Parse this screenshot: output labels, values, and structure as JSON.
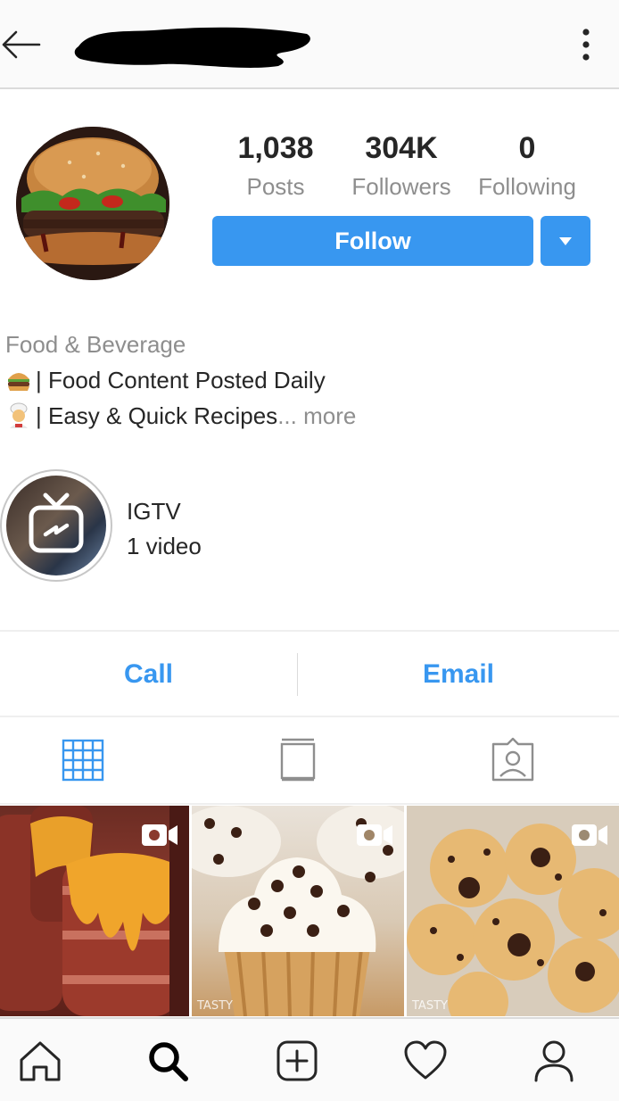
{
  "header": {
    "username_redacted": true,
    "back_icon": "arrow-left-icon",
    "menu_icon": "more-vertical-icon"
  },
  "profile": {
    "stats": [
      {
        "value": "1,038",
        "label": "Posts"
      },
      {
        "value": "304K",
        "label": "Followers"
      },
      {
        "value": "0",
        "label": "Following"
      }
    ],
    "follow_label": "Follow",
    "accent": "#3897f0"
  },
  "bio": {
    "category": "Food & Beverage",
    "line1": "| Food Content Posted Daily",
    "line2": "| Easy  & Quick Recipes",
    "more_label": "... more"
  },
  "igtv": {
    "title": "IGTV",
    "subtitle": "1 video"
  },
  "contact": {
    "call_label": "Call",
    "email_label": "Email"
  },
  "tabs": [
    {
      "icon": "grid-icon",
      "active": true
    },
    {
      "icon": "feed-icon",
      "active": false
    },
    {
      "icon": "tagged-icon",
      "active": false
    }
  ],
  "posts": [
    {
      "subject": "bacon cheese cups",
      "icon": "video-icon"
    },
    {
      "subject": "chocolate chip cupcakes",
      "icon": "video-icon",
      "watermark": "TASTY"
    },
    {
      "subject": "chocolate chip cookies",
      "icon": "video-icon",
      "watermark": "TASTY"
    }
  ],
  "bottom_nav": [
    "home-icon",
    "search-icon",
    "add-post-icon",
    "heart-icon",
    "profile-icon"
  ]
}
